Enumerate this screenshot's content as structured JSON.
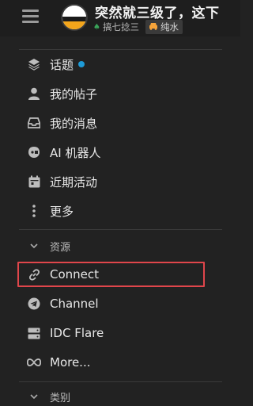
{
  "header": {
    "topic_title": "突然就三级了，这下",
    "author": "搞七捻三",
    "tag": "纯水",
    "colors": {
      "leaf": "#3aa55a",
      "tag_icon": "#f5a33a"
    }
  },
  "sidebar": {
    "main_items": [
      {
        "label": "话题",
        "icon": "layers-icon",
        "unread_dot": true
      },
      {
        "label": "我的帖子",
        "icon": "user-icon"
      },
      {
        "label": "我的消息",
        "icon": "inbox-icon"
      },
      {
        "label": "AI 机器人",
        "icon": "robot-icon"
      },
      {
        "label": "近期活动",
        "icon": "calendar-icon"
      },
      {
        "label": "更多",
        "icon": "more-vertical-icon"
      }
    ],
    "resources": {
      "heading": "资源",
      "items": [
        {
          "label": "Connect",
          "icon": "link-icon",
          "highlighted": true
        },
        {
          "label": "Channel",
          "icon": "telegram-icon"
        },
        {
          "label": "IDC Flare",
          "icon": "server-icon"
        },
        {
          "label": "More...",
          "icon": "infinity-icon"
        }
      ]
    },
    "categories": {
      "heading": "类别"
    },
    "colors": {
      "unread_dot": "#1e9bd7",
      "highlight_border": "#e0464b"
    }
  }
}
